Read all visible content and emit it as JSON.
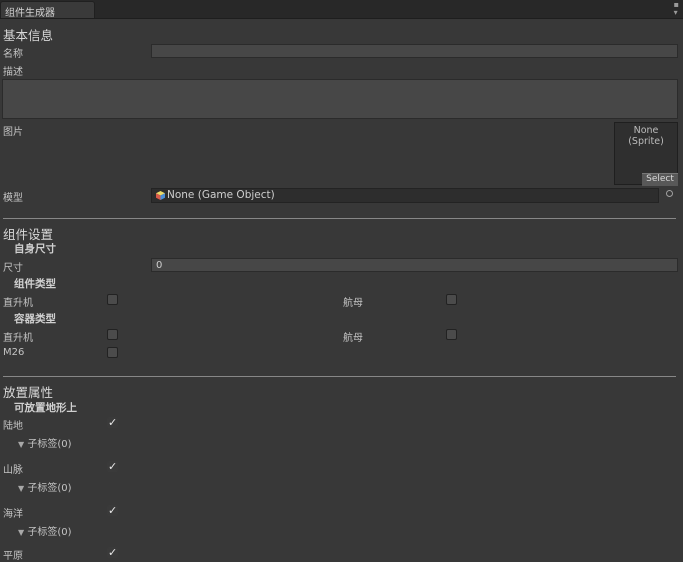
{
  "window": {
    "tab_title": "组件生成器"
  },
  "basic": {
    "section_title": "基本信息",
    "name_label": "名称",
    "name_value": "",
    "desc_label": "描述",
    "desc_value": "",
    "image_label": "图片",
    "image_field": {
      "value_line1": "None",
      "value_line2": "(Sprite)",
      "select_label": "Select"
    },
    "model_label": "模型",
    "model_value": "None (Game Object)"
  },
  "component": {
    "section_title": "组件设置",
    "self_size_title": "自身尺寸",
    "size_label": "尺寸",
    "size_value": "0",
    "component_type_title": "组件类型",
    "component_types": [
      {
        "label": "直升机",
        "checked": false
      },
      {
        "label": "航母",
        "checked": false
      }
    ],
    "container_type_title": "容器类型",
    "container_types": [
      {
        "label": "直升机",
        "checked": false
      },
      {
        "label": "航母",
        "checked": false
      },
      {
        "label": "M26",
        "checked": false
      }
    ]
  },
  "placement": {
    "section_title": "放置属性",
    "terrain_title": "可放置地形上",
    "terrains": [
      {
        "label": "陆地",
        "checked": true,
        "sub": "子标签(0)"
      },
      {
        "label": "山脉",
        "checked": true,
        "sub": "子标签(0)"
      },
      {
        "label": "海洋",
        "checked": true,
        "sub": "子标签(0)"
      },
      {
        "label": "平原",
        "checked": true
      }
    ]
  }
}
